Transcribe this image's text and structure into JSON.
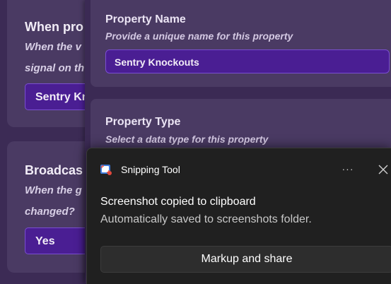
{
  "left_panel": {
    "card1": {
      "title": "When pro",
      "desc_line1": "When the v",
      "desc_line2": "signal on th",
      "value": "Sentry Kn"
    },
    "card2": {
      "title": "Broadcas",
      "desc_line1": "When the g",
      "desc_line2": "changed?",
      "value": "Yes"
    }
  },
  "property_name": {
    "title": "Property Name",
    "subtitle": "Provide a unique name for this property",
    "value": "Sentry Knockouts"
  },
  "property_type": {
    "title": "Property Type",
    "subtitle": "Select a data type for this property"
  },
  "toast": {
    "app_name": "Snipping Tool",
    "more_label": "···",
    "heading": "Screenshot copied to clipboard",
    "body": "Automatically saved to screenshots folder.",
    "button_label": "Markup and share"
  },
  "colors": {
    "background": "#3c2b55",
    "card": "#4a3a63",
    "input_fill": "#4a1e93",
    "toast_bg": "#202020"
  }
}
